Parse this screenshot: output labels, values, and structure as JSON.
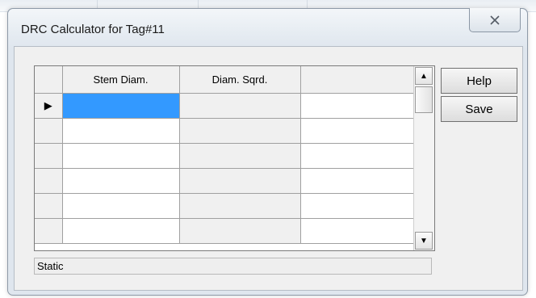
{
  "window": {
    "title": "DRC Calculator for Tag#11",
    "close_glyph": "✕"
  },
  "grid": {
    "columns": [
      "Stem Diam.",
      "Diam. Sqrd.",
      ""
    ],
    "rows": [
      {
        "indicator": "▶",
        "stem_diam": "",
        "diam_sqrd": "",
        "extra": ""
      },
      {
        "indicator": "",
        "stem_diam": "",
        "diam_sqrd": "",
        "extra": ""
      },
      {
        "indicator": "",
        "stem_diam": "",
        "diam_sqrd": "",
        "extra": ""
      },
      {
        "indicator": "",
        "stem_diam": "",
        "diam_sqrd": "",
        "extra": ""
      },
      {
        "indicator": "",
        "stem_diam": "",
        "diam_sqrd": "",
        "extra": ""
      },
      {
        "indicator": "",
        "stem_diam": "",
        "diam_sqrd": "",
        "extra": ""
      }
    ],
    "scroll_up_glyph": "▲",
    "scroll_down_glyph": "▼"
  },
  "buttons": {
    "help": "Help",
    "save": "Save"
  },
  "status_text": "Static",
  "colors": {
    "selection": "#3399ff",
    "dialog_frame": "#dfe6ee"
  }
}
